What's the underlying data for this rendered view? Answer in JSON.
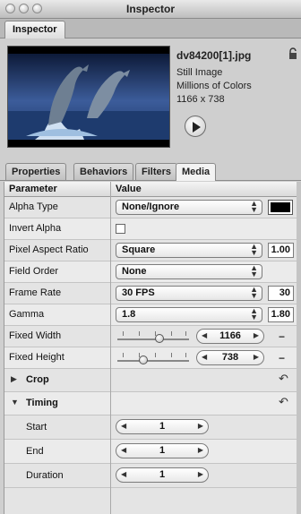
{
  "window": {
    "title": "Inspector"
  },
  "inspector_tab": "Inspector",
  "preview": {
    "filename": "dv84200[1].jpg",
    "type": "Still Image",
    "colors": "Millions of Colors",
    "dimensions": "1166 x 738",
    "play_icon": "play-icon",
    "lock_icon": "lock-icon"
  },
  "subtabs": [
    "Properties",
    "Behaviors",
    "Filters",
    "Media"
  ],
  "active_subtab": "Media",
  "table": {
    "col_parameter": "Parameter",
    "col_value": "Value",
    "rows": {
      "alpha_type": {
        "label": "Alpha Type",
        "value": "None/Ignore",
        "color": "#000000"
      },
      "invert_alpha": {
        "label": "Invert Alpha",
        "checked": false
      },
      "pixel_aspect": {
        "label": "Pixel Aspect Ratio",
        "value": "Square",
        "number": "1.00"
      },
      "field_order": {
        "label": "Field Order",
        "value": "None"
      },
      "frame_rate": {
        "label": "Frame Rate",
        "value": "30 FPS",
        "number": "30"
      },
      "gamma": {
        "label": "Gamma",
        "value": "1.8",
        "number": "1.80"
      },
      "fixed_width": {
        "label": "Fixed Width",
        "value": "1166"
      },
      "fixed_height": {
        "label": "Fixed Height",
        "value": "738"
      },
      "crop": {
        "label": "Crop"
      },
      "timing": {
        "label": "Timing"
      },
      "start": {
        "label": "Start",
        "value": "1"
      },
      "end": {
        "label": "End",
        "value": "1"
      },
      "duration": {
        "label": "Duration",
        "value": "1"
      }
    }
  }
}
